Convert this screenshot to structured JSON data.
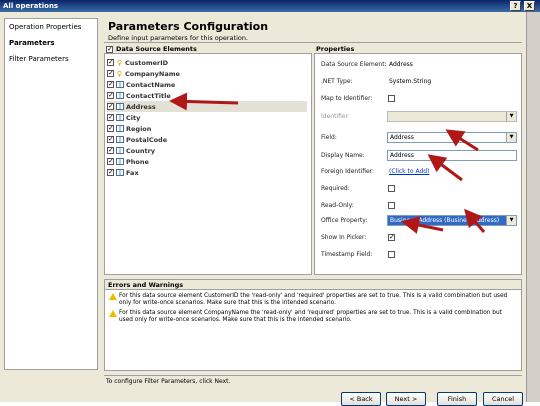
{
  "window": {
    "title": "All operations",
    "help_glyph": "?",
    "close_glyph": "X"
  },
  "nav": {
    "items": [
      {
        "label": "Operation Properties",
        "selected": false
      },
      {
        "label": "Parameters",
        "selected": true
      },
      {
        "label": "Filter Parameters",
        "selected": false
      }
    ]
  },
  "header": {
    "title": "Parameters Configuration",
    "subtitle": "Define input parameters for this operation."
  },
  "datasource": {
    "header_label": "Data Source Elements",
    "header_checked": true,
    "elements": [
      {
        "label": "CustomerID",
        "checked": true,
        "icon": "key-icon"
      },
      {
        "label": "CompanyName",
        "checked": true,
        "icon": "key-icon"
      },
      {
        "label": "ContactName",
        "checked": true,
        "icon": "field-icon"
      },
      {
        "label": "ContactTitle",
        "checked": true,
        "icon": "field-icon"
      },
      {
        "label": "Address",
        "checked": true,
        "icon": "field-icon",
        "selected": true
      },
      {
        "label": "City",
        "checked": true,
        "icon": "field-icon"
      },
      {
        "label": "Region",
        "checked": true,
        "icon": "field-icon"
      },
      {
        "label": "PostalCode",
        "checked": true,
        "icon": "field-icon"
      },
      {
        "label": "Country",
        "checked": true,
        "icon": "field-icon"
      },
      {
        "label": "Phone",
        "checked": true,
        "icon": "field-icon"
      },
      {
        "label": "Fax",
        "checked": true,
        "icon": "field-icon"
      }
    ]
  },
  "properties": {
    "header_label": "Properties",
    "rows": {
      "data_source_element": {
        "label": "Data Source Element:",
        "value": "Address"
      },
      "net_type": {
        "label": ".NET Type:",
        "value": "System.String"
      },
      "map_to_identifier": {
        "label": "Map to Identifier:",
        "checked": false
      },
      "identifier": {
        "label": "Identifier:",
        "value": ""
      },
      "field": {
        "label": "Field:",
        "value": "Address"
      },
      "display_name": {
        "label": "Display Name:",
        "value": "Address"
      },
      "foreign_identifier": {
        "label": "Foreign Identifier:",
        "link": "(Click to Add)"
      },
      "required": {
        "label": "Required:",
        "checked": false
      },
      "read_only": {
        "label": "Read-Only:",
        "checked": false
      },
      "office_property": {
        "label": "Office Property:",
        "value": "Business Address (BusinessAddress)"
      },
      "show_in_picker": {
        "label": "Show In Picker:",
        "checked": true
      },
      "timestamp_field": {
        "label": "Timestamp Field:",
        "checked": false
      }
    }
  },
  "errors": {
    "header_label": "Errors and Warnings",
    "warnings": [
      "For this data source element CustomerID the 'read-only' and 'required' properties are set to true. This is a valid combination but used only for write-once scenarios. Make sure that this is the intended scenario.",
      "For this data source element CompanyName the 'read-only' and 'required' properties are set to true. This is a valid combination but used only for write-once scenarios. Make sure that this is the intended scenario."
    ]
  },
  "footer": {
    "hint": "To configure Filter Parameters, click Next.",
    "back_label": "< Back",
    "next_label": "Next >",
    "finish_label": "Finish",
    "cancel_label": "Cancel"
  },
  "colors": {
    "accent": "#316ac5",
    "annotation_arrow": "#b01818",
    "dialog_bg": "#ece9d8"
  }
}
